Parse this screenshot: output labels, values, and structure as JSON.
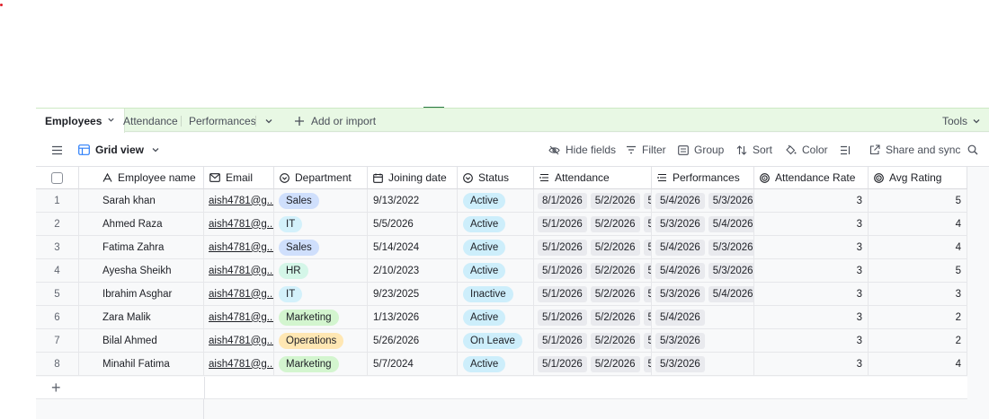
{
  "tabs": [
    {
      "label": "Employees",
      "active": true
    },
    {
      "label": "Attendance",
      "active": false
    },
    {
      "label": "Performances",
      "active": false
    }
  ],
  "add_or_import": "Add or import",
  "tools": "Tools",
  "view": {
    "name": "Grid view"
  },
  "toolbar": {
    "hide_fields": "Hide fields",
    "filter": "Filter",
    "group": "Group",
    "sort": "Sort",
    "color": "Color",
    "share_and_sync": "Share and sync"
  },
  "columns": {
    "name": "Employee name",
    "email": "Email",
    "department": "Department",
    "joining_date": "Joining date",
    "status": "Status",
    "attendance": "Attendance",
    "performances": "Performances",
    "attendance_rate": "Attendance Rate",
    "avg_rating": "Avg Rating"
  },
  "colors": {
    "tablebar_bg": "#e8f8e4",
    "dept_sales": "#cfdffc",
    "dept_it": "#d3f1fb",
    "dept_hr": "#d4f6e8",
    "dept_marketing": "#d3f5cf",
    "dept_operations": "#ffe7b3",
    "status_bg": "#cdeefb"
  },
  "rows": [
    {
      "num": "1",
      "name": "Sarah khan",
      "email": "aish4781@g...",
      "department": "Sales",
      "dept_color": "#cfdffc",
      "joining_date": "9/13/2022",
      "status": "Active",
      "attendance": [
        "8/1/2026",
        "5/2/2026",
        "5/"
      ],
      "performances": [
        "5/4/2026",
        "5/3/2026"
      ],
      "attendance_rate": "3",
      "avg_rating": "5"
    },
    {
      "num": "2",
      "name": "Ahmed Raza",
      "email": "aish4781@g...",
      "department": "IT",
      "dept_color": "#d3f1fb",
      "joining_date": "5/5/2026",
      "status": "Active",
      "attendance": [
        "5/1/2026",
        "5/2/2026",
        "5/"
      ],
      "performances": [
        "5/3/2026",
        "5/4/2026"
      ],
      "attendance_rate": "3",
      "avg_rating": "4"
    },
    {
      "num": "3",
      "name": "Fatima Zahra",
      "email": "aish4781@g...",
      "department": "Sales",
      "dept_color": "#cfdffc",
      "joining_date": "5/14/2024",
      "status": "Active",
      "attendance": [
        "5/1/2026",
        "5/2/2026",
        "5/"
      ],
      "performances": [
        "5/4/2026",
        "5/3/2026"
      ],
      "attendance_rate": "3",
      "avg_rating": "4"
    },
    {
      "num": "4",
      "name": "Ayesha Sheikh",
      "email": "aish4781@g...",
      "department": "HR",
      "dept_color": "#d4f6e8",
      "joining_date": "2/10/2023",
      "status": "Active",
      "attendance": [
        "5/1/2026",
        "5/2/2026",
        "5/"
      ],
      "performances": [
        "5/4/2026",
        "5/3/2026"
      ],
      "attendance_rate": "3",
      "avg_rating": "5"
    },
    {
      "num": "5",
      "name": "Ibrahim Asghar",
      "email": "aish4781@g...",
      "department": "IT",
      "dept_color": "#d3f1fb",
      "joining_date": "9/23/2025",
      "status": "Inactive",
      "attendance": [
        "5/1/2026",
        "5/2/2026",
        "5/"
      ],
      "performances": [
        "5/3/2026",
        "5/4/2026"
      ],
      "attendance_rate": "3",
      "avg_rating": "3"
    },
    {
      "num": "6",
      "name": "Zara Malik",
      "email": "aish4781@g...",
      "department": "Marketing",
      "dept_color": "#d3f5cf",
      "joining_date": "1/13/2026",
      "status": "Active",
      "attendance": [
        "5/1/2026",
        "5/2/2026",
        "5/"
      ],
      "performances": [
        "5/4/2026"
      ],
      "attendance_rate": "3",
      "avg_rating": "2"
    },
    {
      "num": "7",
      "name": "Bilal Ahmed",
      "email": "aish4781@g...",
      "department": "Operations",
      "dept_color": "#ffe7b3",
      "joining_date": "5/26/2026",
      "status": "On Leave",
      "attendance": [
        "5/1/2026",
        "5/2/2026",
        "5/"
      ],
      "performances": [
        "5/3/2026"
      ],
      "attendance_rate": "3",
      "avg_rating": "2"
    },
    {
      "num": "8",
      "name": "Minahil Fatima",
      "email": "aish4781@g...",
      "department": "Marketing",
      "dept_color": "#d3f5cf",
      "joining_date": "5/7/2024",
      "status": "Active",
      "attendance": [
        "5/1/2026",
        "5/2/2026",
        "5/"
      ],
      "performances": [
        "5/3/2026"
      ],
      "attendance_rate": "3",
      "avg_rating": "4"
    }
  ]
}
